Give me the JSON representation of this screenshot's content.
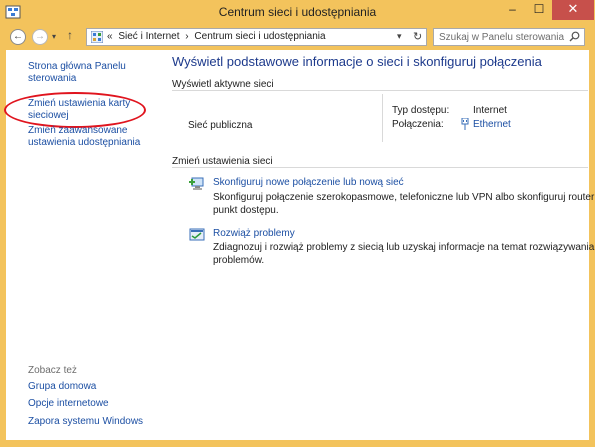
{
  "window": {
    "title": "Centrum sieci i udostępniania",
    "controls": {
      "minimize": "–",
      "maximize": "☐",
      "close": "✕"
    }
  },
  "nav": {
    "back_symbol": "←",
    "forward_symbol": "→",
    "recent_symbol": "▾",
    "up_symbol": "↑",
    "breadcrumb": [
      "«",
      "Sieć i Internet",
      "›",
      "Centrum sieci i udostępniania"
    ],
    "dropdown_symbol": "▾",
    "refresh_symbol": "↻",
    "search_placeholder": "Szukaj w Panelu sterowania"
  },
  "sidebar": {
    "items": [
      {
        "label_line1": "Strona główna Panelu",
        "label_line2": "sterowania"
      },
      {
        "label_line1": "Zmień ustawienia karty",
        "label_line2": "sieciowej"
      },
      {
        "label_line1": "Zmień zaawansowane",
        "label_line2": "ustawienia udostępniania"
      }
    ],
    "see_also_title": "Zobacz też",
    "see_also": [
      "Grupa domowa",
      "Opcje internetowe",
      "Zapora systemu Windows"
    ]
  },
  "main": {
    "heading": "Wyświetl podstawowe informacje o sieci i skonfiguruj połączenia",
    "active_networks_title": "Wyświetl aktywne sieci",
    "network_name": "Sieć publiczna",
    "access_type_label": "Typ dostępu:",
    "access_type_value": "Internet",
    "connections_label": "Połączenia:",
    "connections_value": "Ethernet",
    "change_settings_title": "Zmień ustawienia sieci",
    "tasks": [
      {
        "icon": "new-connection-icon",
        "link": "Skonfiguruj nowe połączenie lub nową sieć",
        "desc_line1": "Skonfiguruj połączenie szerokopasmowe, telefoniczne lub VPN albo skonfiguruj router lub",
        "desc_line2": "punkt dostępu."
      },
      {
        "icon": "troubleshoot-icon",
        "link": "Rozwiąż problemy",
        "desc_line1": "Zdiagnozuj i rozwiąż problemy z siecią lub uzyskaj informacje na temat rozwiązywania",
        "desc_line2": "problemów."
      }
    ]
  },
  "colors": {
    "frame": "#f3c35c",
    "link": "#1c4fa3",
    "heading": "#1d3a8c",
    "highlight_ellipse": "#e0141e",
    "close_button": "#c7504b"
  }
}
